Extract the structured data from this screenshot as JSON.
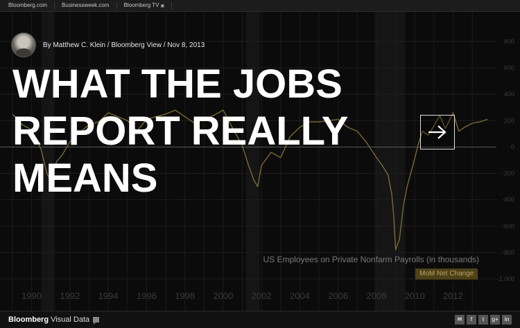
{
  "topbar": {
    "links": [
      {
        "label": "Bloomberg.com"
      },
      {
        "label": "Businessweek.com"
      },
      {
        "label": "Bloomberg TV",
        "ext_icon": "external-link-icon"
      }
    ]
  },
  "byline": {
    "text": "By Matthew C. Klein / Bloomberg View / Nov 8, 2013"
  },
  "headline": {
    "line1": "WHAT THE JOBS",
    "line2": "REPORT REALLY",
    "line3": "MEANS"
  },
  "next_button": {
    "icon": "arrow-right-icon"
  },
  "chart_data": {
    "type": "line",
    "title": "US Employees on Private Nonfarm Payrolls (in thousands)",
    "series_label": "MoM Net Change",
    "ylim": [
      -1000,
      800
    ],
    "y_ticks": [
      "800",
      "600",
      "400",
      "200",
      "0",
      "-200",
      "-400",
      "-600",
      "-800",
      "-1,000"
    ],
    "y_tick_values": [
      800,
      600,
      400,
      200,
      0,
      -200,
      -400,
      -600,
      -800,
      -1000
    ],
    "xlim": [
      1989,
      2013.9
    ],
    "x_ticks": [
      "1990",
      "1992",
      "1994",
      "1996",
      "1998",
      "2000",
      "2002",
      "2004",
      "2006",
      "2008",
      "2010",
      "2012"
    ],
    "x_tick_values": [
      1990,
      1992,
      1994,
      1996,
      1998,
      2000,
      2002,
      2004,
      2006,
      2008,
      2010,
      2012
    ],
    "recessions": [
      [
        1990.5,
        1991.2
      ],
      [
        2001.2,
        2001.9
      ],
      [
        2007.9,
        2009.5
      ]
    ],
    "grid": true,
    "series": [
      {
        "x": [
          1989.0,
          1989.5,
          1990.0,
          1990.5,
          1990.8,
          1991.0,
          1991.3,
          1991.6,
          1992.0,
          1992.5,
          1993.0,
          1993.5,
          1994.0,
          1994.5,
          1995.0,
          1995.5,
          1996.0,
          1996.5,
          1997.0,
          1997.5,
          1998.0,
          1998.5,
          1999.0,
          1999.5,
          2000.0,
          2000.5,
          2001.0,
          2001.3,
          2001.6,
          2001.8,
          2002.0,
          2002.5,
          2003.0,
          2003.5,
          2004.0,
          2004.5,
          2005.0,
          2005.5,
          2006.0,
          2006.5,
          2007.0,
          2007.5,
          2008.0,
          2008.3,
          2008.6,
          2008.8,
          2008.9,
          2009.0,
          2009.2,
          2009.4,
          2009.6,
          2009.9,
          2010.2,
          2010.4,
          2010.7,
          2011.0,
          2011.3,
          2011.6,
          2012.0,
          2012.3,
          2012.6,
          2013.0,
          2013.4,
          2013.8
        ],
        "values": [
          250,
          170,
          130,
          -20,
          -200,
          -260,
          -110,
          -60,
          40,
          110,
          170,
          190,
          260,
          230,
          200,
          120,
          210,
          230,
          250,
          280,
          230,
          180,
          210,
          240,
          280,
          140,
          10,
          -130,
          -250,
          -300,
          -140,
          -40,
          -80,
          80,
          150,
          190,
          190,
          200,
          210,
          150,
          120,
          30,
          -80,
          -140,
          -210,
          -360,
          -520,
          -780,
          -700,
          -450,
          -300,
          -140,
          30,
          120,
          90,
          160,
          240,
          140,
          260,
          120,
          150,
          180,
          190,
          210
        ]
      }
    ]
  },
  "footer": {
    "brand_bold": "Bloomberg",
    "brand_sub": "Visual Data",
    "share_icons": [
      "mail-icon",
      "facebook-icon",
      "twitter-icon",
      "google-plus-icon",
      "linkedin-icon"
    ]
  }
}
